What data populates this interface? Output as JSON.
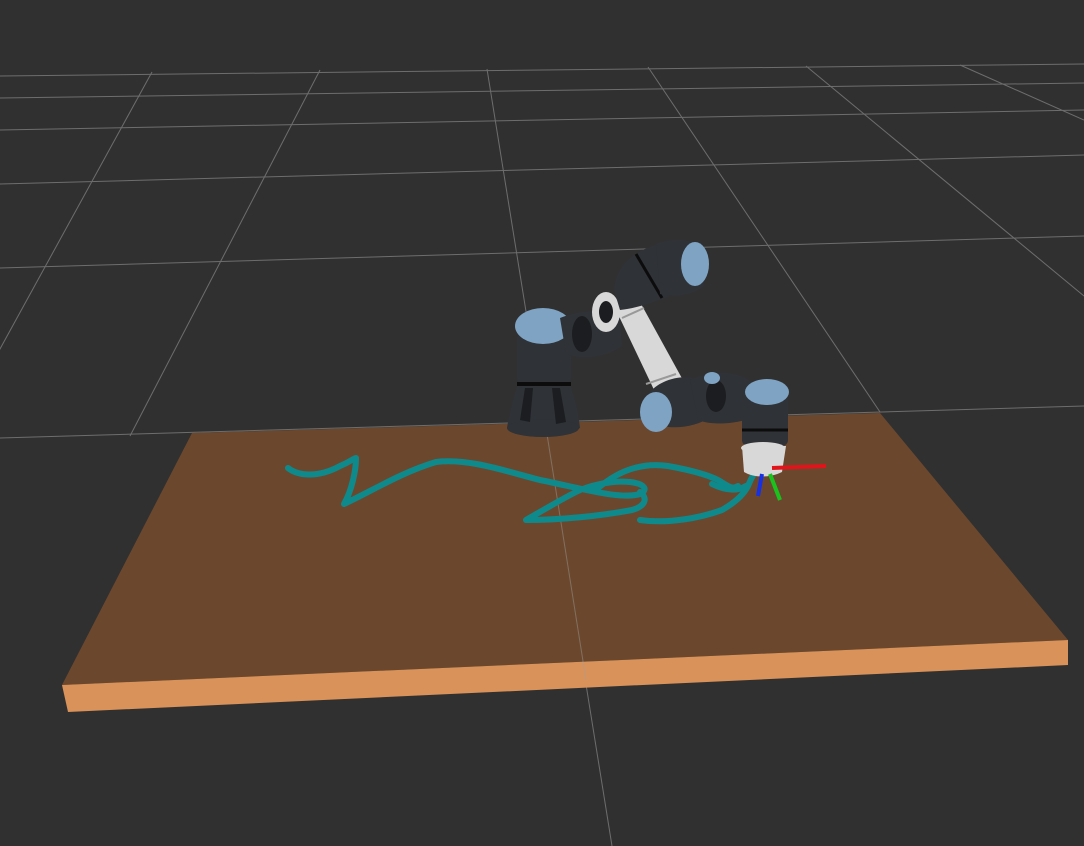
{
  "scene": {
    "background_color": "#303030",
    "grid_color": "#a0a0a0",
    "table": {
      "top_color": "#6b482d",
      "edge_color": "#d99259"
    },
    "trajectory": {
      "color": "#0f8a8c"
    },
    "robot": {
      "body_color": "#2f3236",
      "shade_color": "#1c1d20",
      "cap_color": "#7fa3c3",
      "link_color": "#d8d8d8",
      "band_color": "#0c0c0c"
    },
    "tool_frame": {
      "x_axis_color": "#e0141a",
      "y_axis_color": "#19c21d",
      "z_axis_color": "#1530e6"
    }
  }
}
